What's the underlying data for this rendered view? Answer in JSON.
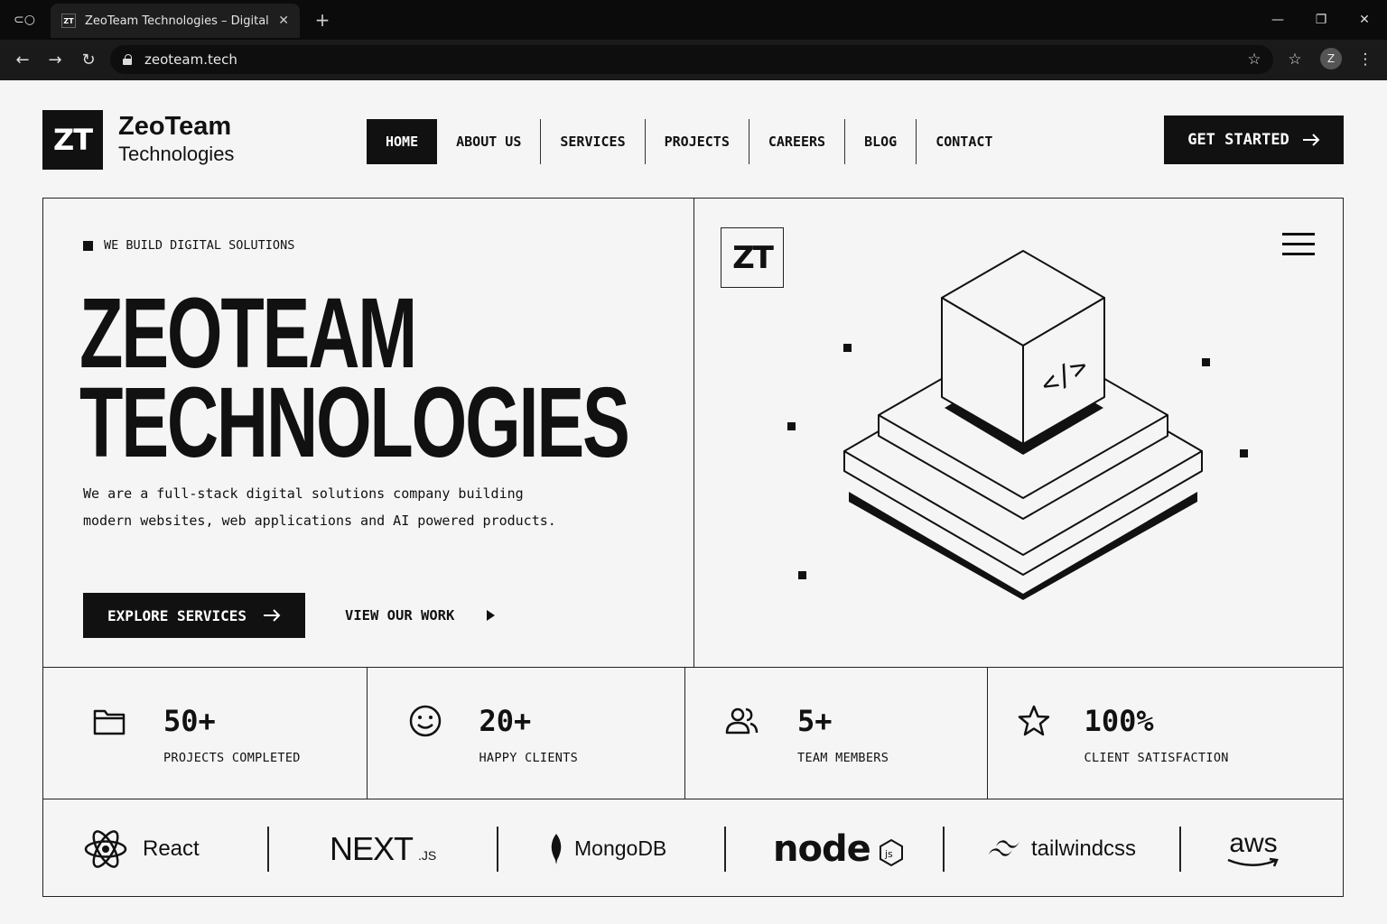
{
  "browser": {
    "tab_title": "ZeoTeam Technologies – Digital Solutions",
    "favicon_text": "ZT",
    "url": "zeoteam.tech",
    "profile_initial": "Z"
  },
  "header": {
    "logo_text": "ZT",
    "brand_name": "ZeoTeam",
    "brand_sub": "Technologies",
    "nav": [
      "HOME",
      "ABOUT US",
      "SERVICES",
      "PROJECTS",
      "CAREERS",
      "BLOG",
      "CONTACT"
    ],
    "active_nav": "HOME",
    "cta_label": "GET STARTED"
  },
  "hero": {
    "eyebrow": "WE BUILD DIGITAL SOLUTIONS",
    "headline_line1": "ZEOTEAM",
    "headline_line2": "TECHNOLOGIES",
    "description": "We are a full-stack digital solutions company building modern websites, web applications and AI powered products.",
    "primary_button": "EXPLORE SERVICES",
    "secondary_button": "VIEW OUR WORK",
    "mark_text": "ZT",
    "code_glyph": "</>"
  },
  "stats": [
    {
      "icon": "folder-icon",
      "value": "50+",
      "label": "PROJECTS COMPLETED"
    },
    {
      "icon": "smile-icon",
      "value": "20+",
      "label": "HAPPY CLIENTS"
    },
    {
      "icon": "team-icon",
      "value": "5+",
      "label": "TEAM MEMBERS"
    },
    {
      "icon": "star-icon",
      "value": "100%",
      "label": "CLIENT SATISFACTION"
    }
  ],
  "tech": {
    "react": "React",
    "next": "NEXT",
    "next_suffix": ".JS",
    "mongodb": "MongoDB",
    "node": "node",
    "node_badge": "js",
    "tailwind": "tailwindcss",
    "aws": "aws"
  },
  "colors": {
    "primary": "#111111",
    "background": "#f5f5f5",
    "chrome": "#0b0b0b"
  }
}
